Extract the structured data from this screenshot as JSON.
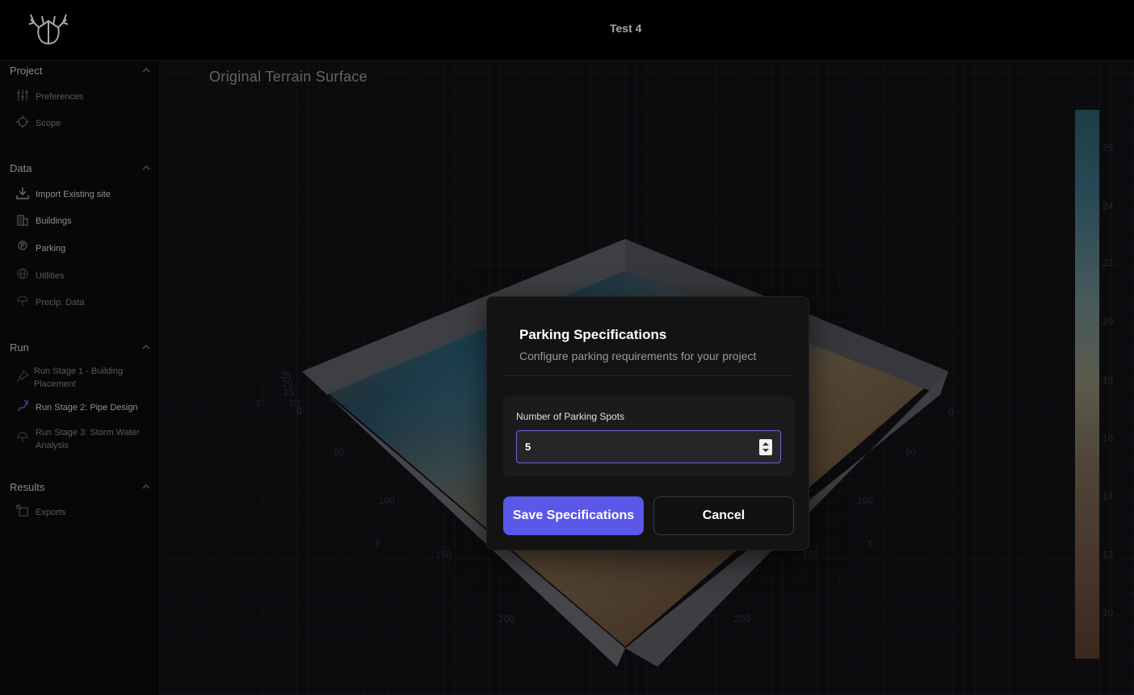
{
  "header": {
    "project_title": "Test 4",
    "logo_icon": "deer-antler-logo-icon"
  },
  "sidebar": {
    "sections": [
      {
        "title": "Project",
        "items": [
          {
            "label": "Preferences",
            "icon": "sliders-icon"
          },
          {
            "label": "Scope",
            "icon": "crosshair-icon"
          }
        ]
      },
      {
        "title": "Data",
        "items": [
          {
            "label": "Import Existing site",
            "icon": "download-icon"
          },
          {
            "label": "Buildings",
            "icon": "building-icon"
          },
          {
            "label": "Parking",
            "icon": "parking-icon"
          },
          {
            "label": "Utilities",
            "icon": "globe-icon"
          },
          {
            "label": "Precip. Data",
            "icon": "umbrella-icon"
          }
        ]
      },
      {
        "title": "Run",
        "items": [
          {
            "label": "Run Stage 1 - Building Placement",
            "icon": "pin-icon"
          },
          {
            "label": "Run Stage 2: Pipe Design",
            "icon": "pipe-icon"
          },
          {
            "label": "Run Stage 3: Storm Water Analysis",
            "icon": "umbrella-icon"
          }
        ]
      },
      {
        "title": "Results",
        "items": [
          {
            "label": "Exports",
            "icon": "export-icon"
          }
        ]
      }
    ]
  },
  "main": {
    "plot_title": "Original Terrain Surface",
    "colorbar_ticks": [
      "26",
      "24",
      "22",
      "20",
      "18",
      "16",
      "14",
      "12",
      "10"
    ],
    "axis_labels": {
      "x": "x",
      "y": "y",
      "z": "z"
    },
    "axis_ticks": [
      "0",
      "50",
      "100",
      "150",
      "200",
      "0",
      "50",
      "100",
      "150",
      "200",
      "0",
      "10",
      "15",
      "20",
      "25"
    ]
  },
  "modal": {
    "title": "Parking Specifications",
    "description": "Configure parking requirements for your project",
    "field_label": "Number of Parking Spots",
    "field_value": "5",
    "save_label": "Save Specifications",
    "cancel_label": "Cancel",
    "accent_color": "#5b57e8"
  }
}
